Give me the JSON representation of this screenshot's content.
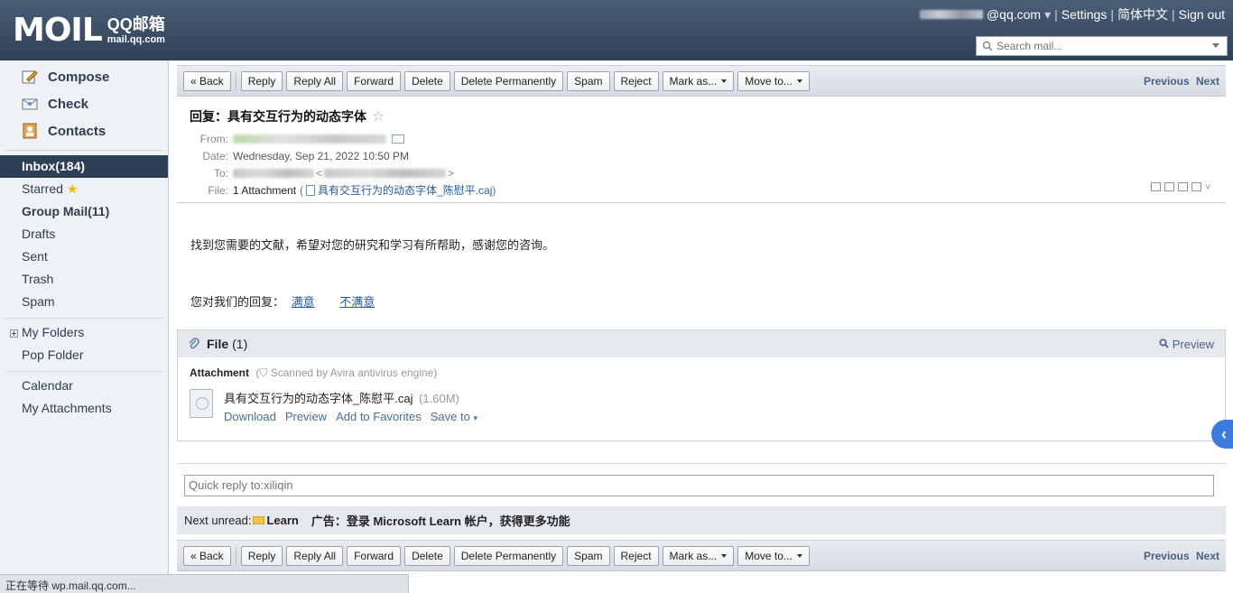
{
  "header": {
    "logo_mark": "MOIL",
    "logo_line1": "QQ邮箱",
    "logo_line2": "mail.qq.com",
    "account_suffix": "@qq.com",
    "account_caret": "▾",
    "links": [
      "Settings",
      "简体中文",
      "Sign out"
    ],
    "search_placeholder": "Search mail..."
  },
  "sidebar": {
    "actions": [
      {
        "label": "Compose",
        "icon": "compose-icon"
      },
      {
        "label": "Check",
        "icon": "check-mail-icon"
      },
      {
        "label": "Contacts",
        "icon": "contacts-icon"
      }
    ],
    "folders": [
      {
        "label": "Inbox(184)"
      },
      {
        "label": "Starred"
      },
      {
        "label": "Group Mail(11)"
      },
      {
        "label": "Drafts"
      },
      {
        "label": "Sent"
      },
      {
        "label": "Trash"
      },
      {
        "label": "Spam"
      }
    ],
    "my_folders": "My Folders",
    "pop_folder": "Pop Folder",
    "calendar": "Calendar",
    "my_attachments": "My Attachments"
  },
  "toolbar": {
    "back": "« Back",
    "reply": "Reply",
    "reply_all": "Reply All",
    "forward": "Forward",
    "delete": "Delete",
    "delete_permanently": "Delete Permanently",
    "spam": "Spam",
    "reject": "Reject",
    "mark_as": "Mark as...",
    "move_to": "Move to...",
    "previous": "Previous",
    "next": "Next"
  },
  "message": {
    "subject": "回复：具有交互行为的动态字体",
    "from_label": "From:",
    "date_label": "Date:",
    "date": "Wednesday, Sep 21, 2022 10:50 PM",
    "to_label": "To:",
    "file_label": "File:",
    "attachment_count": "1 Attachment",
    "attachment_name": "具有交互行为的动态字体_陈慰平.caj",
    "body_line1": "找到您需要的文献，希望对您的研究和学习有所帮助，感谢您的咨询。",
    "feedback_prompt": "您对我们的回复：",
    "satisfied": "满意",
    "unsatisfied": "不满意"
  },
  "files": {
    "title": "File",
    "count": "(1)",
    "preview": "Preview",
    "attachment_label": "Attachment",
    "scan_note": "Scanned by Avira antivirus engine",
    "file_name": "具有交互行为的动态字体_陈慰平.caj",
    "file_size": "(1.60M)",
    "actions": [
      "Download",
      "Preview",
      "Add to Favorites",
      "Save to"
    ]
  },
  "quick_reply": {
    "placeholder": "Quick reply to:xiliqin"
  },
  "next_unread": {
    "label": "Next unread:",
    "subject": "Learn",
    "ad": "广告：登录 Microsoft Learn 帐户，获得更多功能"
  },
  "status_text": "正在等待 wp.mail.qq.com..."
}
